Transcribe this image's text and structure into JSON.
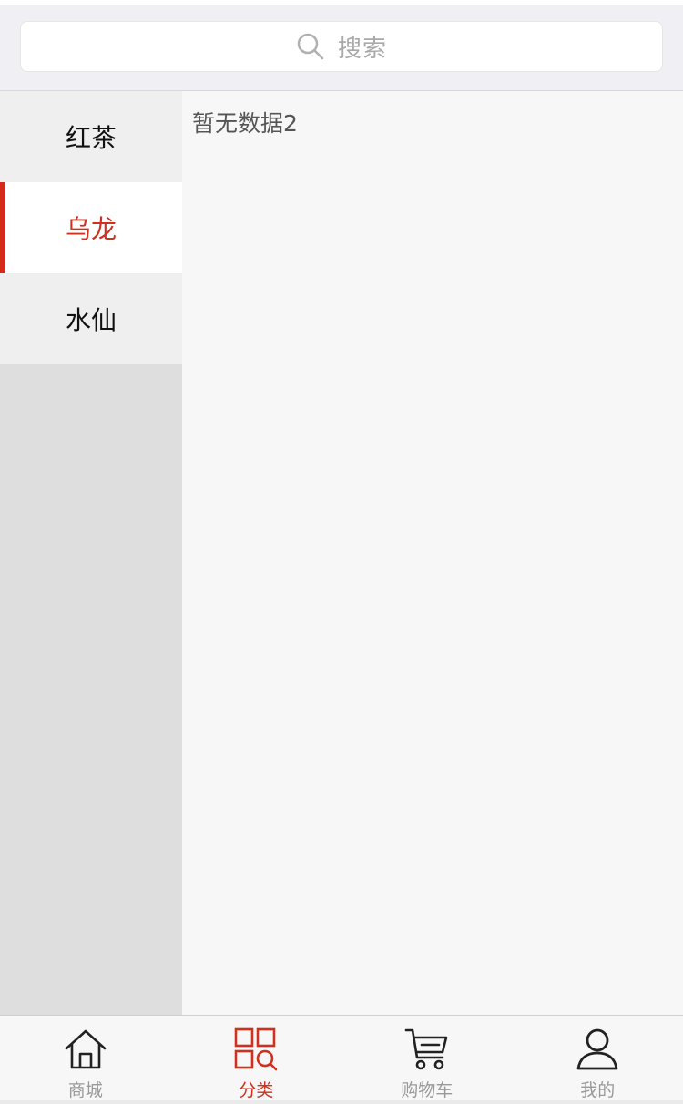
{
  "search": {
    "placeholder": "搜索"
  },
  "sidebar": {
    "items": [
      {
        "label": "红茶",
        "active": false
      },
      {
        "label": "乌龙",
        "active": true
      },
      {
        "label": "水仙",
        "active": false
      }
    ]
  },
  "main": {
    "empty_text": "暂无数据2"
  },
  "tabbar": {
    "tabs": [
      {
        "label": "商城",
        "icon": "home-icon",
        "active": false
      },
      {
        "label": "分类",
        "icon": "category-icon",
        "active": true
      },
      {
        "label": "购物车",
        "icon": "cart-icon",
        "active": false
      },
      {
        "label": "我的",
        "icon": "user-icon",
        "active": false
      }
    ]
  },
  "colors": {
    "accent": "#d0301e",
    "inactive_tab_text": "#999999"
  }
}
